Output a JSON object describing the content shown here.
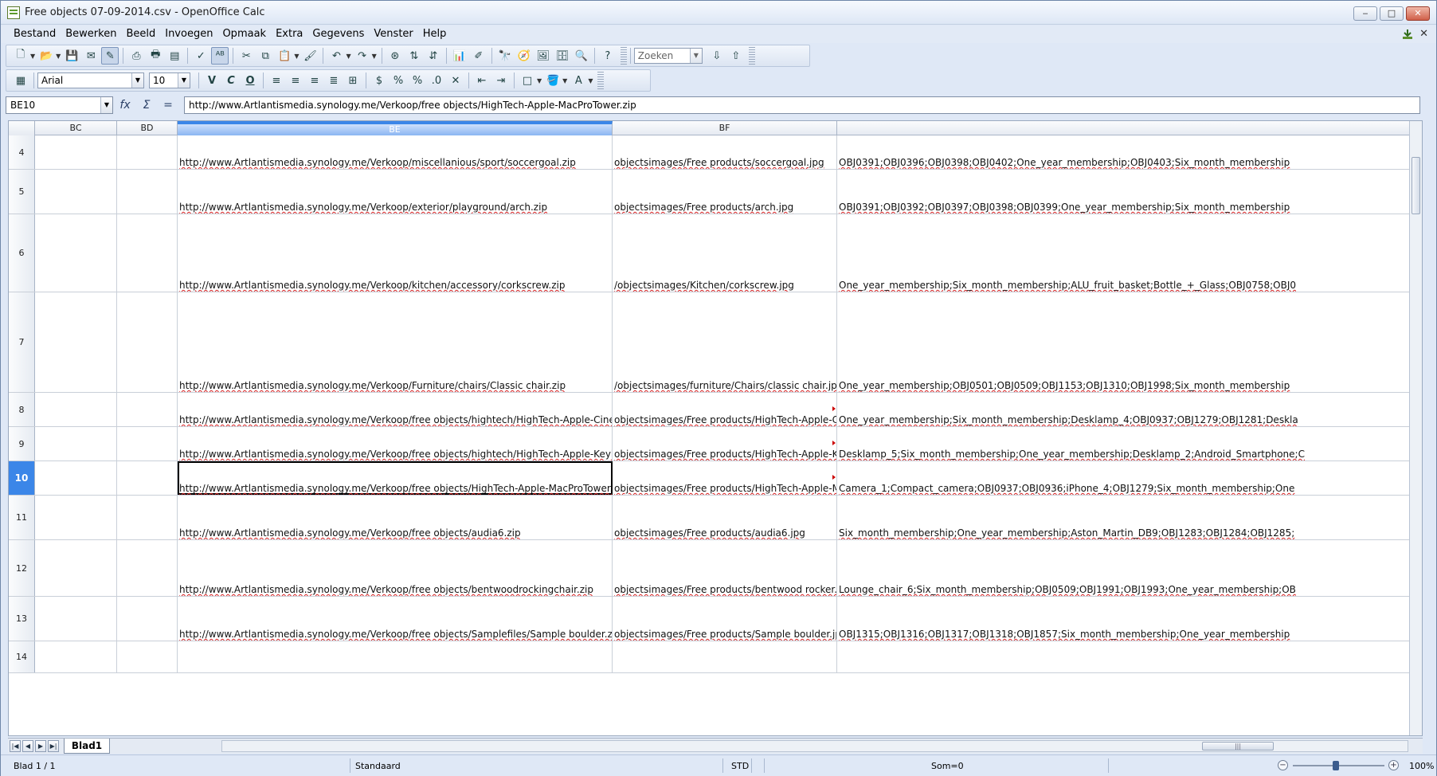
{
  "window": {
    "title": "Free objects 07-09-2014.csv - OpenOffice Calc",
    "minimize": "‒",
    "maximize": "□",
    "close": "✕"
  },
  "menu": [
    "Bestand",
    "Bewerken",
    "Beeld",
    "Invoegen",
    "Opmaak",
    "Extra",
    "Gegevens",
    "Venster",
    "Help"
  ],
  "menu_underline": [
    "B",
    "w",
    "B",
    "I",
    "O",
    "E",
    "G",
    "V",
    "H"
  ],
  "toolbar": {
    "search_placeholder": "Zoeken",
    "font_name": "Arial",
    "font_size": "10",
    "bold": "V",
    "italic": "C",
    "underline": "O"
  },
  "formula_bar": {
    "cell_ref": "BE10",
    "fx": "fx",
    "sigma": "Σ",
    "equals": "=",
    "content": "http://www.Artlantismedia.synology.me/Verkoop/free objects/HighTech-Apple-MacProTower.zip"
  },
  "columns": [
    "BC",
    "BD",
    "BE",
    "BF",
    ""
  ],
  "selected_column": "BE",
  "rows": [
    {
      "num": "4",
      "be": "http://www.Artlantismedia.synology.me/Verkoop/miscellanious/sport/soccergoal.zip",
      "bf": "objectsimages/Free products/soccergoal.jpg",
      "bg": "OBJ0391;OBJ0396;OBJ0398;OBJ0402;One_year_membership;OBJ0403;Six_month_membership"
    },
    {
      "num": "5",
      "be": "http://www.Artlantismedia.synology.me/Verkoop/exterior/playground/arch.zip",
      "bf": "objectsimages/Free products/arch.jpg",
      "bg": "OBJ0391;OBJ0392;OBJ0397;OBJ0398;OBJ0399;One_year_membership;Six_month_membership"
    },
    {
      "num": "6",
      "be": "http://www.Artlantismedia.synology.me/Verkoop/kitchen/accessory/corkscrew.zip",
      "bf": "/objectsimages/Kitchen/corkscrew.jpg",
      "bg": "One_year_membership;Six_month_membership;ALU_fruit_basket;Bottle_+_Glass;OBJ0758;OBJ0"
    },
    {
      "num": "7",
      "be": "http://www.Artlantismedia.synology.me/Verkoop/Furniture/chairs/Classic chair.zip",
      "bf": "/objectsimages/furniture/Chairs/classic chair.jpg",
      "bg": "One_year_membership;OBJ0501;OBJ0509;OBJ1153;OBJ1310;OBJ1998;Six_month_membership"
    },
    {
      "num": "8",
      "be": "http://www.Artlantismedia.synology.me/Verkoop/free objects/hightech/HighTech-Apple-CinemaDisplay.zip",
      "bf": "objectsimages/Free products/HighTech-Apple-CinemaD",
      "bg": "One_year_membership;Six_month_membership;Desklamp_4;OBJ0937;OBJ1279;OBJ1281;Deskla"
    },
    {
      "num": "9",
      "be": "http://www.Artlantismedia.synology.me/Verkoop/free objects/hightech/HighTech-Apple-Keyboard.zip",
      "bf": "objectsimages/Free products/HighTech-Apple-Keyboard",
      "bg": "Desklamp_5;Six_month_membership;One_year_membership;Desklamp_2;Android_Smartphone;C"
    },
    {
      "num": "10",
      "be": "http://www.Artlantismedia.synology.me/Verkoop/free objects/HighTech-Apple-MacProTower.zip",
      "bf": "objectsimages/Free products/HighTech-Apple-MacProT",
      "bg": "Camera_1;Compact_camera;OBJ0937;OBJ0936;iPhone_4;OBJ1279;Six_month_membership;One"
    },
    {
      "num": "11",
      "be": "http://www.Artlantismedia.synology.me/Verkoop/free objects/audia6.zip",
      "bf": "objectsimages/Free products/audia6.jpg",
      "bg": "Six_month_membership;One_year_membership;Aston_Martin_DB9;OBJ1283;OBJ1284;OBJ1285;"
    },
    {
      "num": "12",
      "be": "http://www.Artlantismedia.synology.me/Verkoop/free objects/bentwoodrockingchair.zip",
      "bf": "objectsimages/Free products/bentwood rocker.jpg",
      "bg": "Lounge_chair_6;Six_month_membership;OBJ0509;OBJ1991;OBJ1993;One_year_membership;OB"
    },
    {
      "num": "13",
      "be": "http://www.Artlantismedia.synology.me/Verkoop/free objects/Samplefiles/Sample boulder.zip",
      "bf": "objectsimages/Free products/Sample boulder.jpg",
      "bg": "OBJ1315;OBJ1316;OBJ1317;OBJ1318;OBJ1857;Six_month_membership;One_year_membership"
    },
    {
      "num": "14",
      "be": "",
      "bf": "",
      "bg": ""
    }
  ],
  "sheet_tab": "Blad1",
  "status": {
    "sheet": "Blad 1 / 1",
    "style": "Standaard",
    "mode": "STD",
    "sum": "Som=0",
    "zoom": "100%"
  }
}
